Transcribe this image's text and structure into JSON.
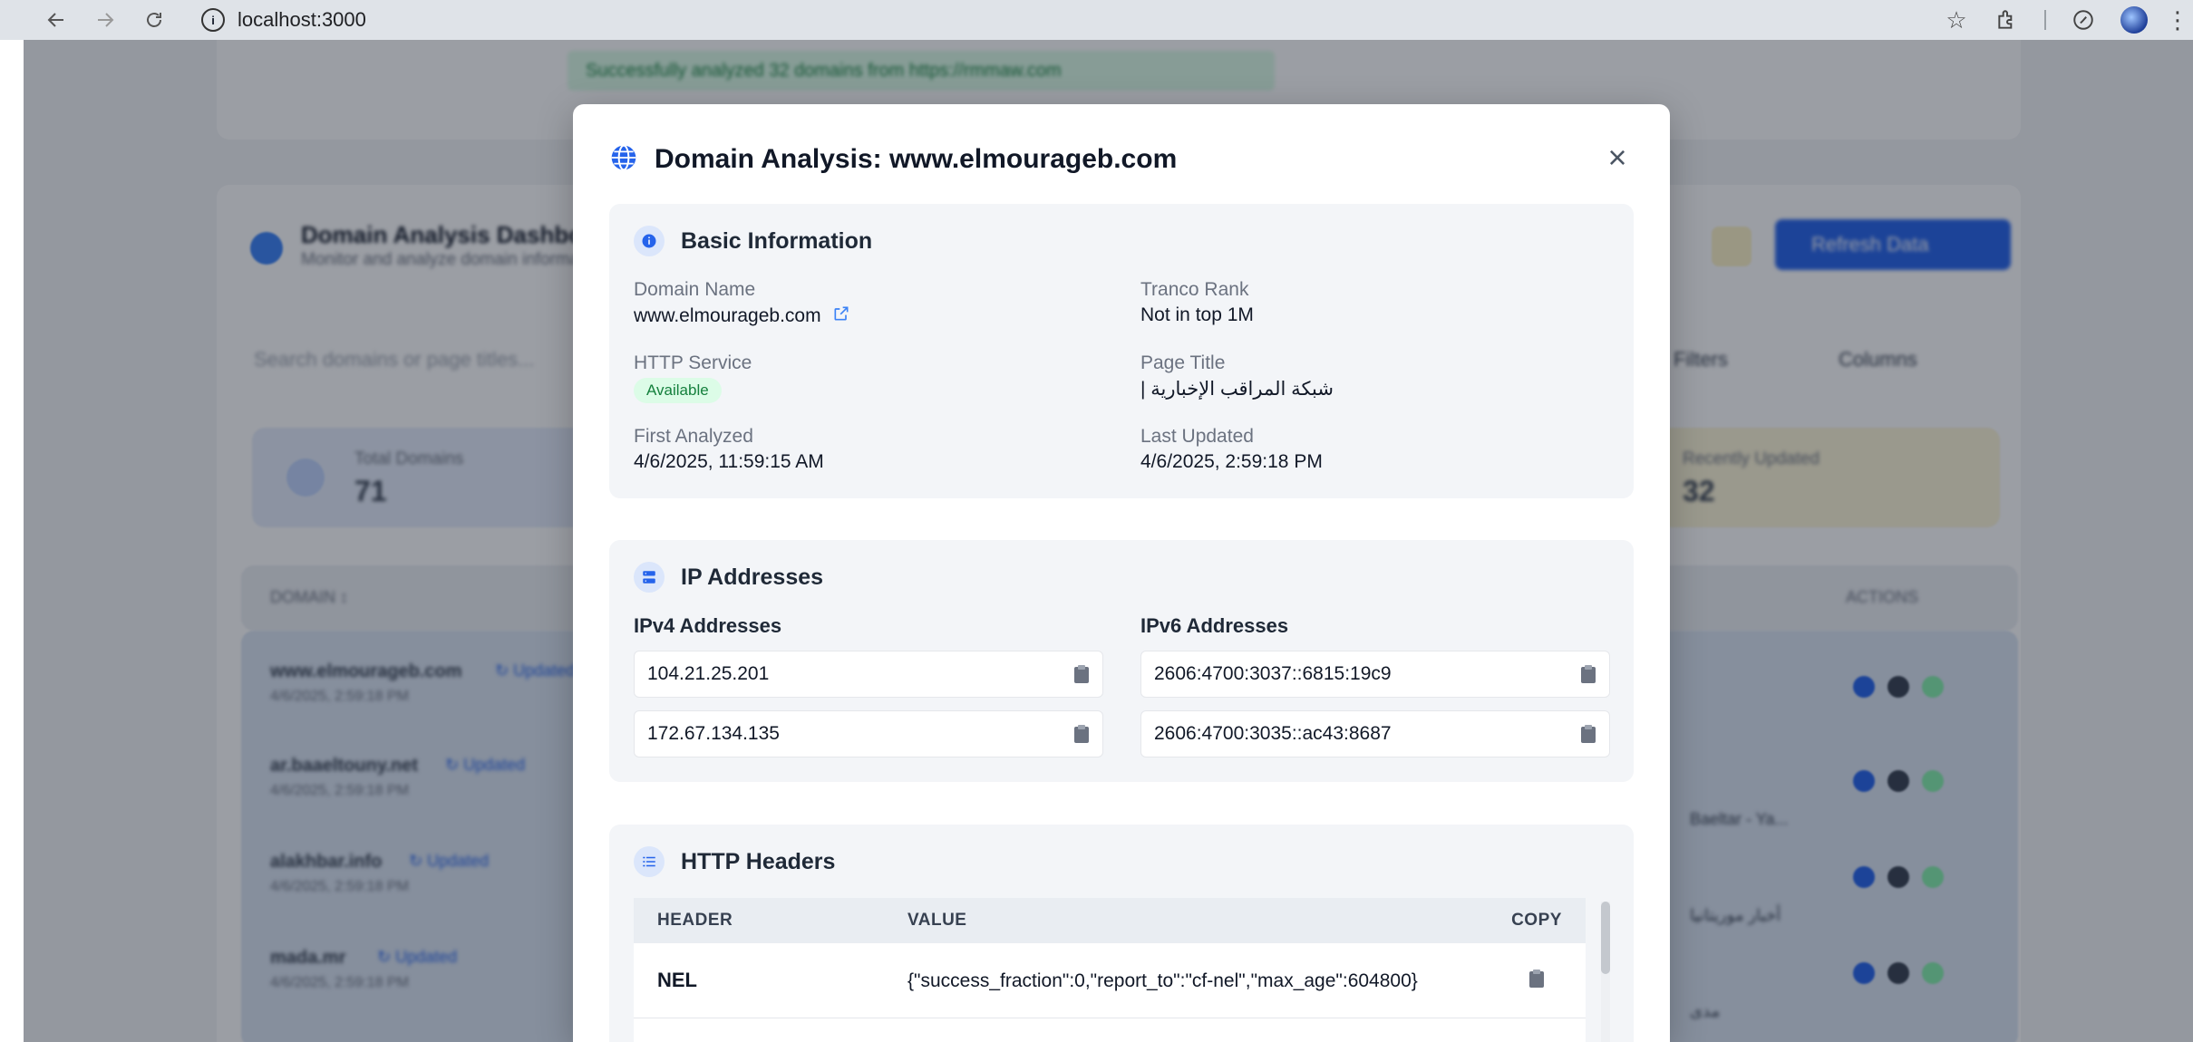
{
  "browser": {
    "url": "localhost:3000"
  },
  "background": {
    "success_message": "Successfully analyzed 32 domains from https://rmmaw.com",
    "dashboard_title": "Domain Analysis Dashboard",
    "dashboard_subtitle": "Monitor and analyze domain information",
    "refresh_label": "Refresh Data",
    "search_placeholder": "Search domains or page titles...",
    "filter_label": "Filters",
    "columns_label": "Columns",
    "total_domains_label": "Total Domains",
    "total_domains_value": "71",
    "recently_updated_label": "Recently Updated",
    "recently_updated_value": "32",
    "col_domain": "DOMAIN ↕",
    "col_actions": "ACTIONS",
    "rows": [
      {
        "domain": "www.elmourageb.com",
        "tag": "↻ Updated",
        "date": "4/6/2025, 2:59:18 PM",
        "title": ""
      },
      {
        "domain": "ar.baaeltouny.net",
        "tag": "↻ Updated",
        "date": "4/6/2025, 2:59:18 PM",
        "title": "Baeltar - Ya..."
      },
      {
        "domain": "alakhbar.info",
        "tag": "↻ Updated",
        "date": "4/6/2025, 2:59:18 PM",
        "title": "أخبار موريتانيا"
      },
      {
        "domain": "mada.mr",
        "tag": "↻ Updated",
        "date": "4/6/2025, 2:59:18 PM",
        "title": "مدى"
      }
    ]
  },
  "modal": {
    "title": "Domain Analysis: www.elmourageb.com",
    "basic": {
      "title": "Basic Information",
      "domain_name_label": "Domain Name",
      "domain_name": "www.elmourageb.com",
      "tranco_label": "Tranco Rank",
      "tranco_value": "Not in top 1M",
      "http_label": "HTTP Service",
      "http_status": "Available",
      "page_title_label": "Page Title",
      "page_title": "شبكة المراقب الإخبارية |",
      "first_label": "First Analyzed",
      "first_value": "4/6/2025, 11:59:15 AM",
      "last_label": "Last Updated",
      "last_value": "4/6/2025, 2:59:18 PM"
    },
    "ip": {
      "title": "IP Addresses",
      "v4_label": "IPv4 Addresses",
      "v6_label": "IPv6 Addresses",
      "v4": [
        "104.21.25.201",
        "172.67.134.135"
      ],
      "v6": [
        "2606:4700:3037::6815:19c9",
        "2606:4700:3035::ac43:8687"
      ]
    },
    "headers": {
      "title": "HTTP Headers",
      "col_header": "HEADER",
      "col_value": "VALUE",
      "col_copy": "COPY",
      "rows": [
        {
          "name": "NEL",
          "value": "{\"success_fraction\":0,\"report_to\":\"cf-nel\",\"max_age\":604800}"
        }
      ]
    }
  },
  "icons": {
    "back": "arrow-left-icon",
    "forward": "arrow-right-icon",
    "reload": "reload-icon",
    "info": "info-icon",
    "star": "star-icon",
    "extensions": "puzzle-icon",
    "globe": "globe-icon",
    "close": "close-icon",
    "external_link": "external-link-icon",
    "clipboard": "clipboard-icon",
    "server": "server-icon",
    "list": "list-icon"
  },
  "colors": {
    "accent": "#2563eb",
    "success_bg": "#dcfce7",
    "success_text": "#15803d",
    "section_bg": "#f3f5f8"
  }
}
